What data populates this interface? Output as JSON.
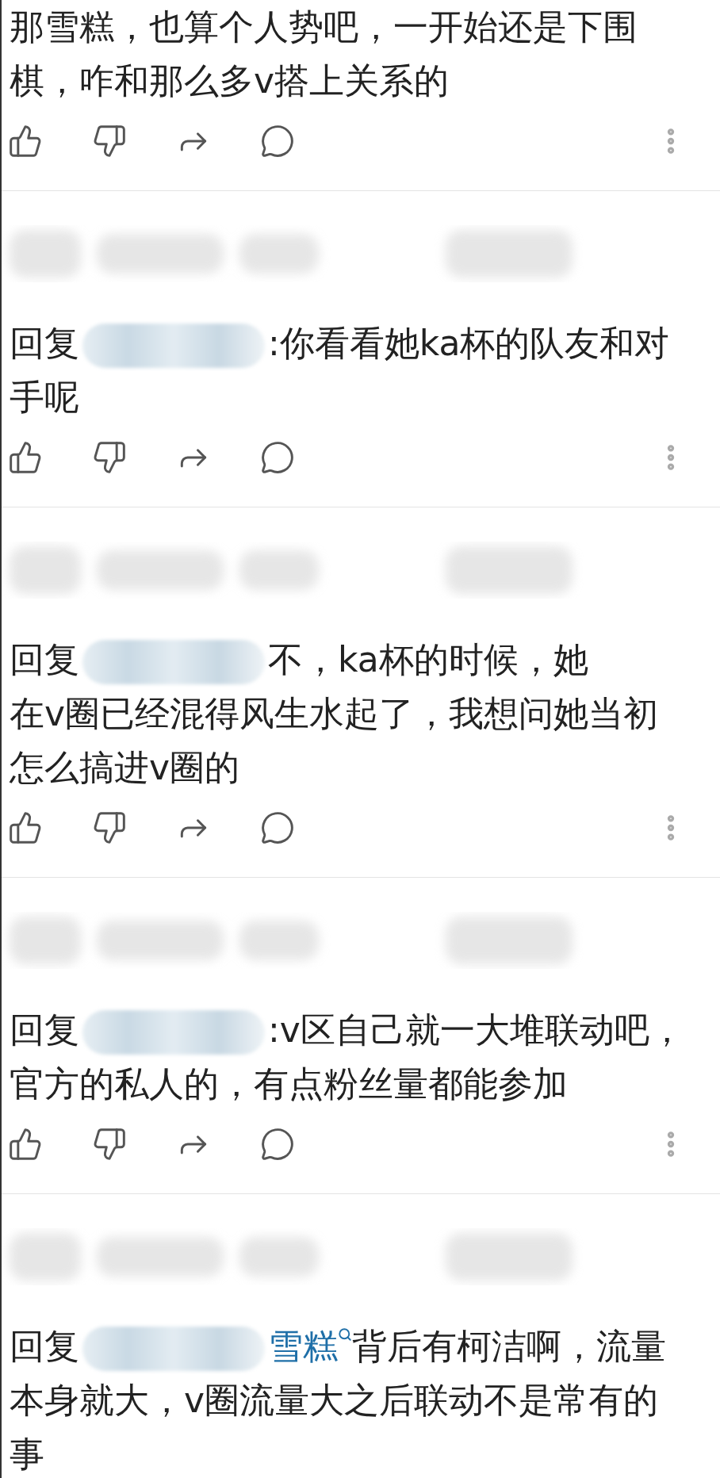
{
  "comments": [
    {
      "kind": "plain",
      "lines": [
        "那雪糕，也算个人势吧，一开始还是下围",
        "棋，咋和那么多v搭上关系的"
      ]
    },
    {
      "kind": "reply",
      "prefix": "回复",
      "lines": [
        ":你看看她ka杯的队友和对",
        "手呢"
      ]
    },
    {
      "kind": "reply",
      "prefix": "回复",
      "lines": [
        "不，ka杯的时候，她",
        "在v圈已经混得风生水起了，我想问她当初",
        "怎么搞进v圈的"
      ]
    },
    {
      "kind": "reply",
      "prefix": "回复",
      "lines": [
        ":v区自己就一大堆联动吧，",
        "官方的私人的，有点粉丝量都能参加"
      ]
    },
    {
      "kind": "reply",
      "prefix": "回复",
      "link": "雪糕",
      "lines": [
        "背后有柯洁啊，流量",
        "本身就大，v圈流量大之后联动不是常有的",
        "事"
      ]
    }
  ]
}
